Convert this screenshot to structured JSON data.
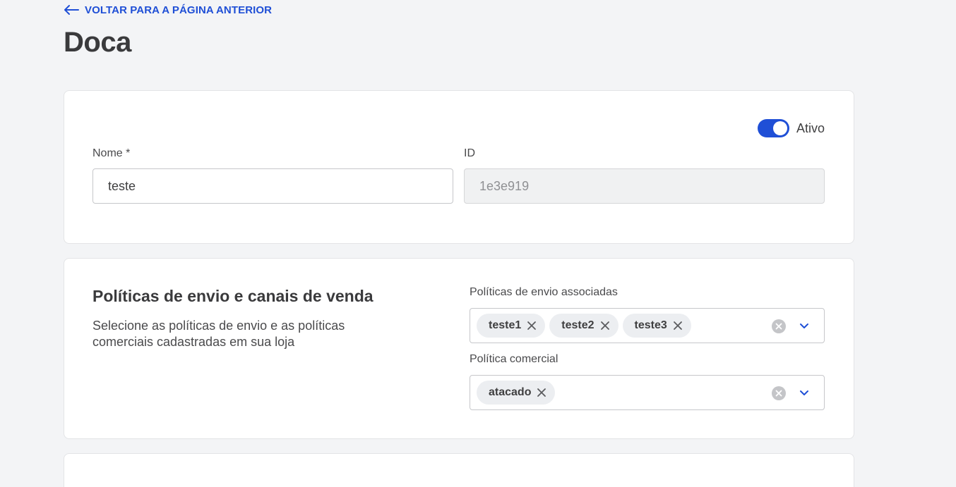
{
  "nav": {
    "back_label": "VOLTAR PARA A PÁGINA ANTERIOR"
  },
  "page": {
    "title": "Doca"
  },
  "general": {
    "status_label": "Ativo",
    "status_on": true,
    "name_label": "Nome *",
    "name_value": "teste",
    "id_label": "ID",
    "id_value": "1e3e919"
  },
  "policies": {
    "title": "Políticas de envio e canais de venda",
    "description": "Selecione as políticas de envio e as políticas comerciais cadastradas em sua loja",
    "shipping_label": "Políticas de envio associadas",
    "shipping_tags": [
      "teste1",
      "teste2",
      "teste3"
    ],
    "commercial_label": "Política comercial",
    "commercial_tags": [
      "atacado"
    ]
  },
  "colors": {
    "accent": "#1f4fd6",
    "background": "#f3f4f6",
    "card": "#ffffff",
    "chip": "#eceef1"
  }
}
